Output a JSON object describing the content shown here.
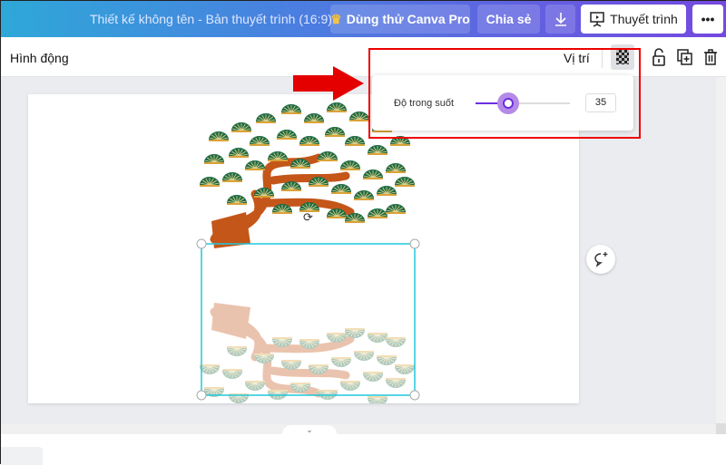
{
  "header": {
    "title": "Thiết kế không tên - Bản thuyết trình (16:9)",
    "try_pro": "Dùng thử Canva Pro",
    "share": "Chia sẻ",
    "present": "Thuyết trình",
    "more": "•••"
  },
  "toolbar": {
    "animate": "Hình động",
    "position": "Vị trí"
  },
  "transparency_popup": {
    "label": "Độ trong suốt",
    "value": "35",
    "percent": 35
  },
  "colors": {
    "accent": "#6a2ee0",
    "selection": "#1fc8db",
    "highlight": "#e00000"
  }
}
